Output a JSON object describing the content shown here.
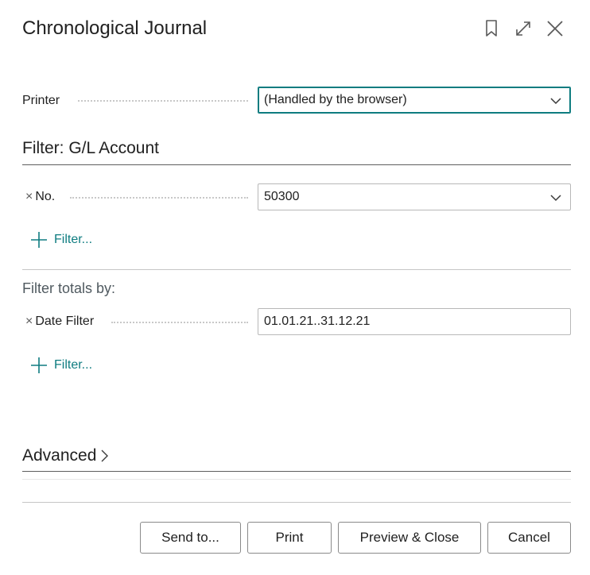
{
  "dialog": {
    "title": "Chronological Journal",
    "icons": [
      "bookmark-icon",
      "expand-icon",
      "close-icon"
    ]
  },
  "printer": {
    "label": "Printer",
    "value": "(Handled by the browser)"
  },
  "filter_section": {
    "title": "Filter: G/L Account",
    "no_label": "No.",
    "no_value": "50300",
    "add_filter": "Filter..."
  },
  "totals_section": {
    "title": "Filter totals by:",
    "date_label": "Date Filter",
    "date_value": "01.01.21..31.12.21",
    "add_filter": "Filter..."
  },
  "advanced": {
    "label": "Advanced"
  },
  "buttons": {
    "send_to": "Send to...",
    "print": "Print",
    "preview_close": "Preview & Close",
    "cancel": "Cancel"
  },
  "colors": {
    "accent": "#0e7c80",
    "text": "#212121"
  }
}
